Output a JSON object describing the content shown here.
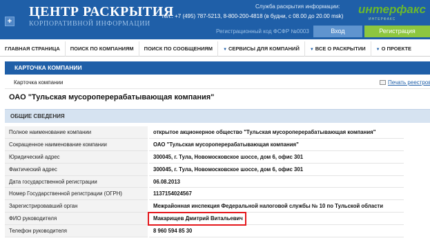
{
  "header": {
    "logo_icon": "+",
    "title": "ЦЕНТР РАСКРЫТИЯ",
    "subtitle": "КОРПОРАТИВНОЙ ИНФОРМАЦИИ",
    "service_title": "Служба раскрытия информации:",
    "phone_line": "тел.: +7 (495) 787-5213, 8-800-200-4818 (в будни, с 08.00 до 20.00 msk)",
    "partner_logo": "интерфакс",
    "partner_sub": "ИНТЕРФАКС",
    "reg_code": "Регистрационный код ФСФР №0003",
    "login_label": "Вход",
    "register_label": "Регистрация"
  },
  "nav": {
    "items": [
      "ГЛАВНАЯ СТРАНИЦА",
      "ПОИСК ПО КОМПАНИЯМ",
      "ПОИСК ПО СООБЩЕНИЯМ",
      "СЕРВИСЫ ДЛЯ КОМПАНИЙ",
      "ВСЕ О РАСКРЫТИИ",
      "О ПРОЕКТЕ"
    ]
  },
  "card": {
    "header": "КАРТОЧКА КОМПАНИИ",
    "breadcrumb": "Карточка компании",
    "print_link": "Печать реестров",
    "company_title": "ОАО \"Тульская мусороперерабатывающая компания\"",
    "section_title": "ОБЩИЕ СВЕДЕНИЯ"
  },
  "info_rows": [
    {
      "label": "Полное наименование компании",
      "value": "открытое акционерное общество \"Тульская мусороперерабатывающая компания\""
    },
    {
      "label": "Сокращенное наименование компании",
      "value": "ОАО \"Тульская мусороперерабатывающая компания\""
    },
    {
      "label": "Юридический адрес",
      "value": "300045, г. Тула, Новомосковское шоссе, дом 6, офис 301"
    },
    {
      "label": "Фактический адрес",
      "value": "300045, г. Тула, Новомосковское шоссе, дом 6, офис 301"
    },
    {
      "label": "Дата государственной регистрации",
      "value": "06.08.2013"
    },
    {
      "label": "Номер Государственной регистрации (ОГРН)",
      "value": "1137154024567"
    },
    {
      "label": "Зарегистрировавший орган",
      "value": "Межрайонная инспекция Федеральной налоговой службы № 10 по Тульской области"
    },
    {
      "label": "ФИО руководителя",
      "value": "Макарищев Дмитрий Витальевич"
    },
    {
      "label": "Телефон руководителя",
      "value": "8 960 594 85 30"
    }
  ],
  "colors": {
    "brand_blue": "#1f5fa8",
    "register_green": "#8dc63f",
    "highlight_red": "#e4161b"
  }
}
